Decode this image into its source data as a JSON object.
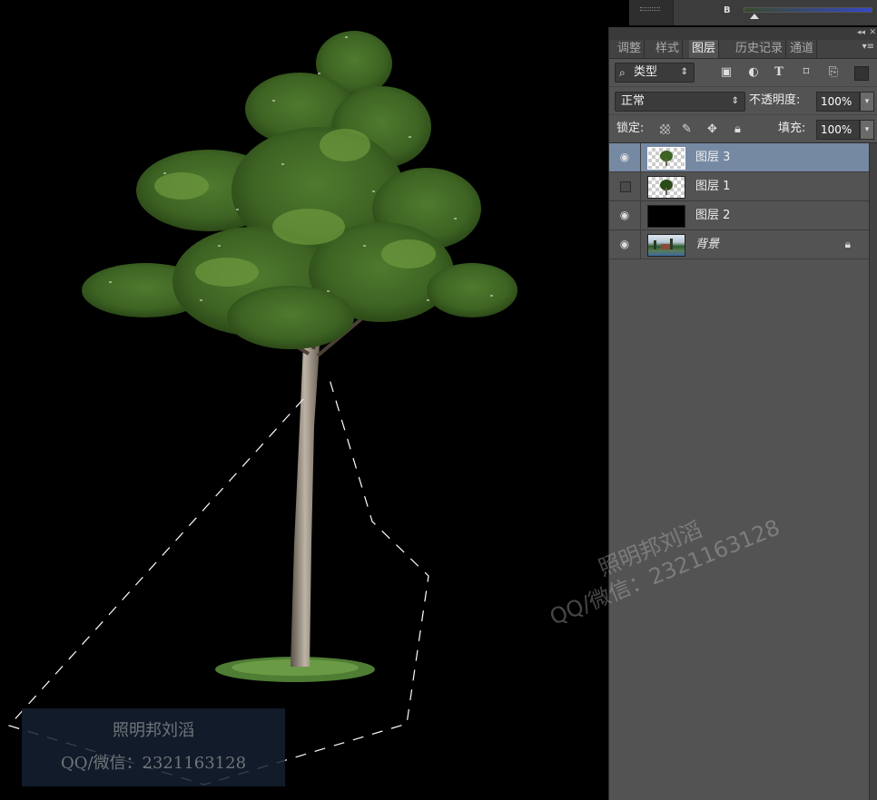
{
  "top_strip": {
    "channel_label": "B"
  },
  "panel": {
    "collapse_glyph": "◂◂",
    "close_glyph": "✕",
    "menu_glyph": "▾≡",
    "tabs": [
      {
        "label": "调整"
      },
      {
        "label": "样式"
      },
      {
        "label": "图层"
      },
      {
        "label": "历史记录"
      },
      {
        "label": "通道"
      }
    ],
    "active_tab": "图层",
    "filter": {
      "label": "类型",
      "icon": "search-icon"
    },
    "blend_mode": "正常",
    "opacity_label": "不透明度:",
    "opacity_value": "100%",
    "lock_label": "锁定:",
    "fill_label": "填充:",
    "fill_value": "100%",
    "layers": [
      {
        "name": "图层 3",
        "visible": true,
        "selected": true,
        "thumb": "tree-transparent"
      },
      {
        "name": "图层 1",
        "visible": false,
        "selected": false,
        "thumb": "tree-transparent"
      },
      {
        "name": "图层 2",
        "visible": true,
        "selected": false,
        "thumb": "black"
      },
      {
        "name": "背景",
        "visible": true,
        "selected": false,
        "thumb": "photo",
        "locked": true
      }
    ]
  },
  "watermarks": {
    "line1": "照明邦刘滔",
    "line2": "QQ/微信：2321163128"
  },
  "colors": {
    "panel_bg": "#535353",
    "selected_layer": "#7589a3",
    "canvas_bg": "#000000"
  }
}
